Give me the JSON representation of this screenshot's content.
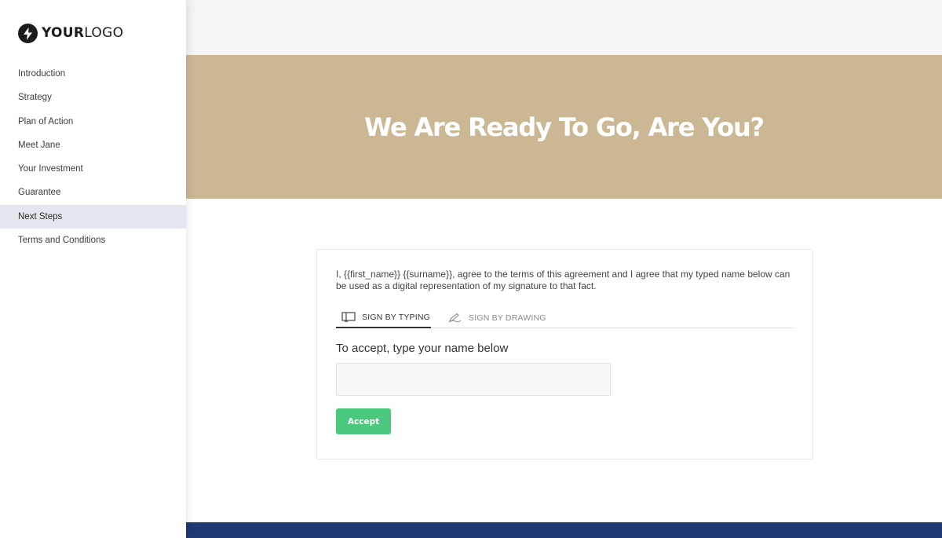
{
  "logo": {
    "bold": "YOUR",
    "light": "LOGO"
  },
  "nav": {
    "items": [
      {
        "label": "Introduction"
      },
      {
        "label": "Strategy"
      },
      {
        "label": "Plan of Action"
      },
      {
        "label": "Meet Jane"
      },
      {
        "label": "Your Investment"
      },
      {
        "label": "Guarantee"
      },
      {
        "label": "Next Steps",
        "active": true
      },
      {
        "label": "Terms and Conditions"
      }
    ]
  },
  "hero": {
    "title": "We Are Ready To Go, Are You?"
  },
  "signature": {
    "agreement_text": "I, {{first_name}} {{surname}}, agree to the terms of this agreement and I agree that my typed name below can be used as a digital representation of my signature to that fact.",
    "tabs": [
      {
        "label": "SIGN BY TYPING",
        "icon": "keyboard-icon",
        "active": true
      },
      {
        "label": "SIGN BY DRAWING",
        "icon": "pen-icon",
        "active": false
      }
    ],
    "prompt": "To accept, type your name below",
    "input_value": "",
    "input_placeholder": "",
    "button_label": "Accept"
  },
  "colors": {
    "hero_bg": "#cbb793",
    "accept_button": "#4ac97e",
    "footer_bar": "#1e3a73",
    "nav_active_bg": "#e4e7ee"
  }
}
